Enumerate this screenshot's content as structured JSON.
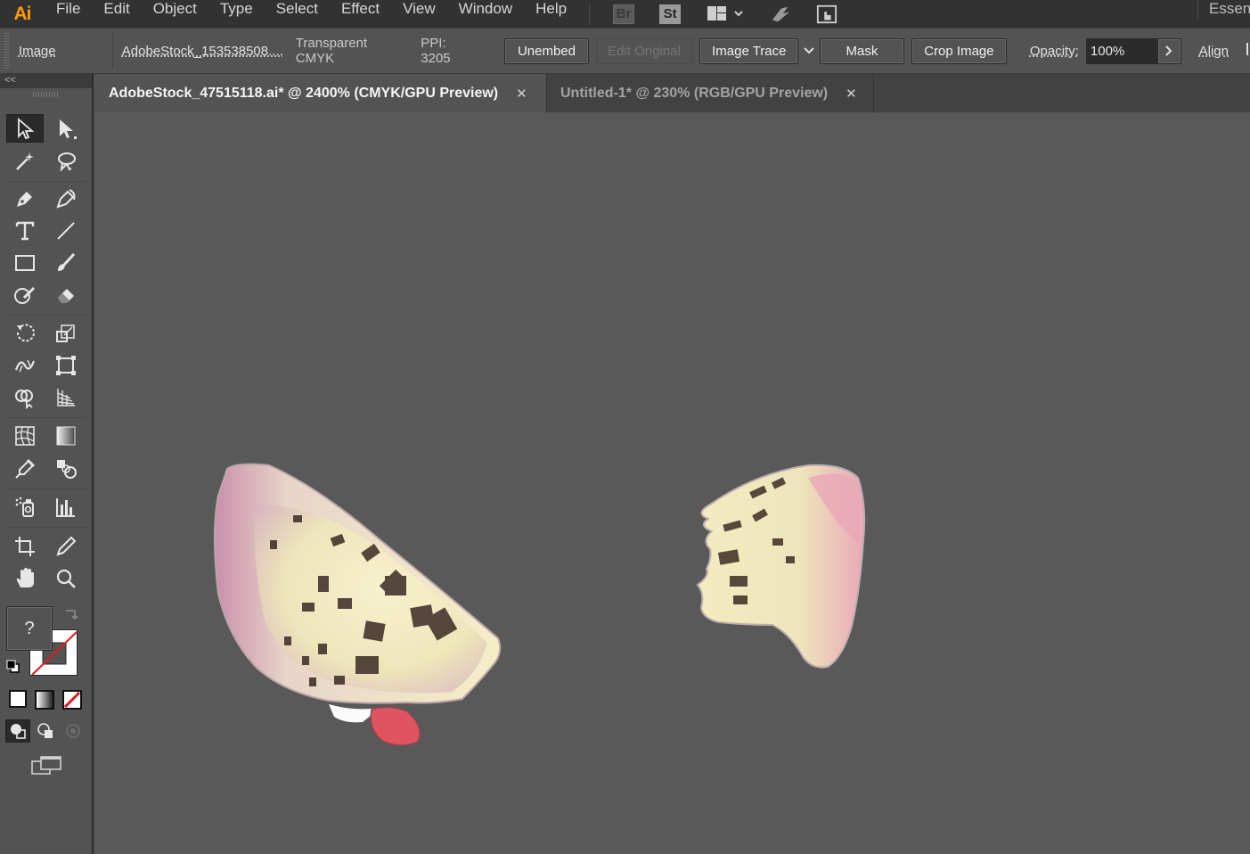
{
  "app": {
    "logo": "Ai"
  },
  "menu": [
    "File",
    "Edit",
    "Object",
    "Type",
    "Select",
    "Effect",
    "View",
    "Window",
    "Help"
  ],
  "topbar": {
    "bridge_label": "Br",
    "stock_label": "St",
    "workspace": "Essent"
  },
  "controlbar": {
    "object_type": "Image",
    "file_name": "AdobeStock_153538508....",
    "color_mode": "Transparent CMYK",
    "ppi": "PPI: 3205",
    "unembed": "Unembed",
    "edit_original": "Edit Original",
    "image_trace": "Image Trace",
    "mask": "Mask",
    "crop_image": "Crop Image",
    "opacity_label": "Opacity:",
    "opacity_value": "100%",
    "align": "Align"
  },
  "tools_panel": {
    "collapse_label": "<<",
    "fill_unknown": "?"
  },
  "tabs": [
    {
      "label": "AdobeStock_47515118.ai* @ 2400% (CMYK/GPU Preview)",
      "active": true
    },
    {
      "label": "Untitled-1* @ 230% (RGB/GPU Preview)",
      "active": false
    }
  ],
  "colors": {
    "accent": "#ff9a00",
    "menubar": "#323232",
    "panel": "#535353",
    "canvas": "#595959"
  }
}
